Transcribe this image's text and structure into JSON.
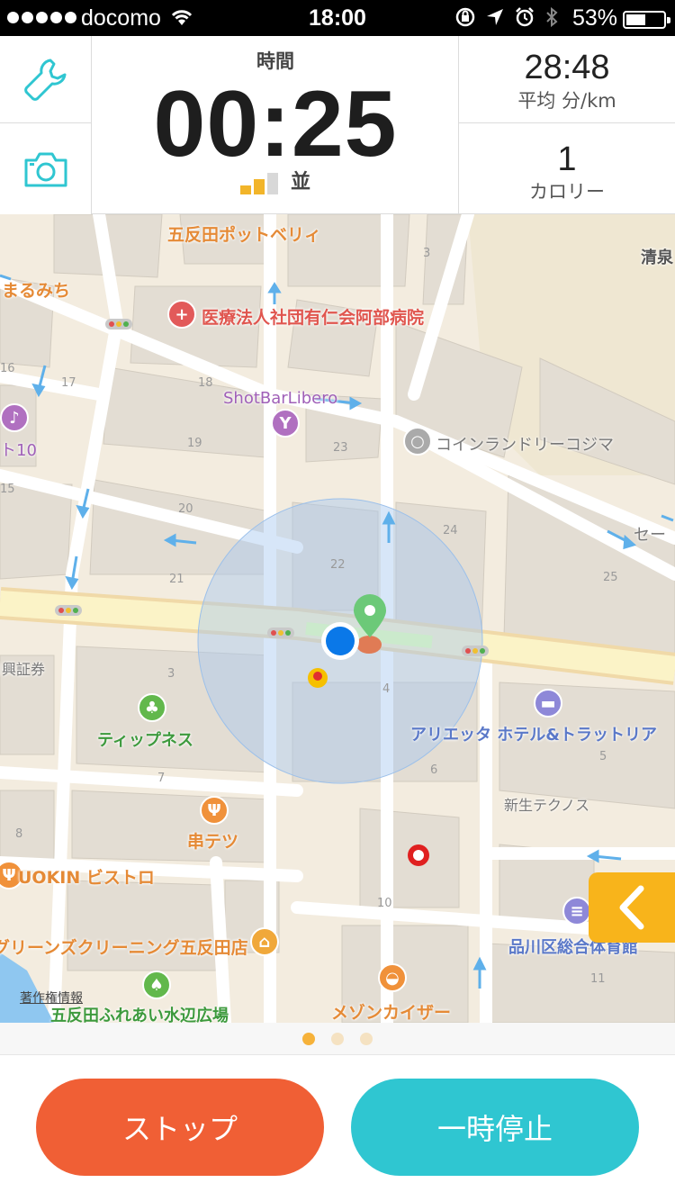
{
  "status_bar": {
    "carrier": "docomo",
    "time": "18:00",
    "battery_percent": "53%",
    "battery_level": 0.53
  },
  "header": {
    "time_label": "時間",
    "time_value": "00:25",
    "signal_level": 2,
    "signal_label": "並",
    "pace_value": "28:48",
    "pace_label": "平均 分/km",
    "calories_value": "1",
    "calories_label": "カロリー"
  },
  "map": {
    "labels": {
      "pottobelly": "五反田ポットベリィ",
      "marumichi": "まるみち",
      "hospital": "医療法人社団有仁会阿部病院",
      "shotbar": "ShotBarLibero",
      "to10": "ト10",
      "laundry": "コインランドリーコジマ",
      "se": "セー",
      "kiyo": "清泉",
      "nikko": "日興証券",
      "tippness": "ティップネス",
      "arietta": "アリエッタ ホテル&トラットリア",
      "shinsei": "新生テクノス",
      "kushitetsu": "串テツ",
      "uokin": "UOKIN ビストロ",
      "cleaning": "グリーンズクリーニング五反田店",
      "shinagawa": "品川区総合体育館",
      "copyright": "著作権情報",
      "park": "五反田ふれあい水辺広場",
      "kaiser": "メゾンカイザー"
    },
    "block_numbers": [
      "3",
      "16",
      "17",
      "18",
      "19",
      "23",
      "15",
      "20",
      "24",
      "21",
      "22",
      "25",
      "3",
      "4",
      "5",
      "6",
      "7",
      "8",
      "10",
      "11"
    ]
  },
  "pager": {
    "count": 3,
    "active_index": 0
  },
  "buttons": {
    "stop_label": "ストップ",
    "pause_label": "一時停止"
  },
  "colors": {
    "accent_teal": "#2fc6d1",
    "stop_orange": "#f05f35",
    "side_tab_yellow": "#f8b41b",
    "signal_active": "#f2b52a",
    "signal_inactive": "#d8d8d8"
  }
}
